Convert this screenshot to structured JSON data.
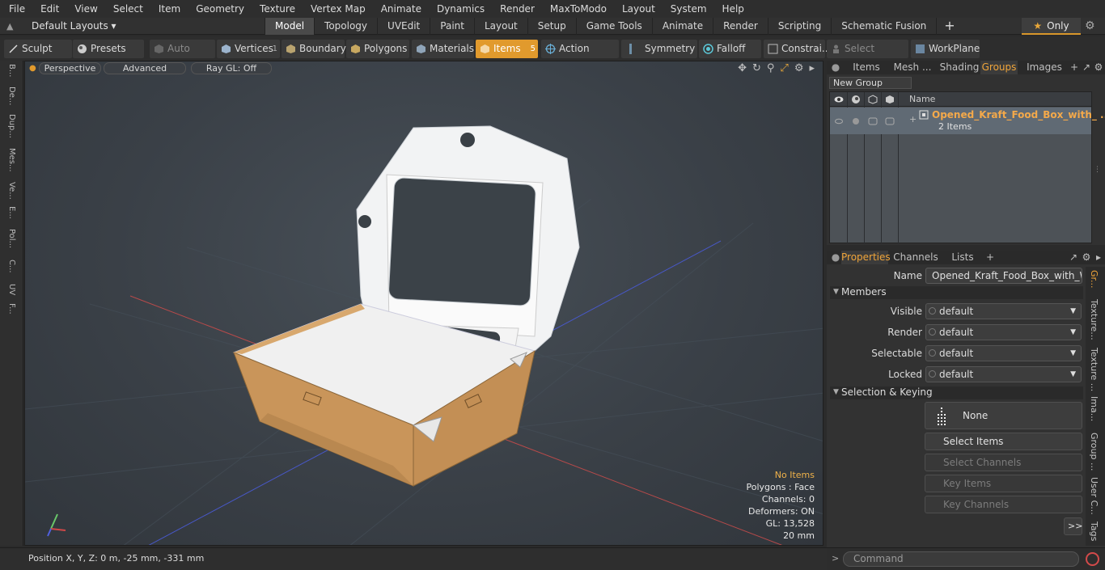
{
  "menu": [
    "File",
    "Edit",
    "View",
    "Select",
    "Item",
    "Geometry",
    "Texture",
    "Vertex Map",
    "Animate",
    "Dynamics",
    "Render",
    "MaxToModo",
    "Layout",
    "System",
    "Help"
  ],
  "layouts_label": "Default Layouts",
  "tabs": [
    "Model",
    "Topology",
    "UVEdit",
    "Paint",
    "Layout",
    "Setup",
    "Game Tools",
    "Animate",
    "Render",
    "Scripting",
    "Schematic Fusion"
  ],
  "active_tab": "Model",
  "only_label": "Only",
  "toolbar": {
    "sculpt": "Sculpt",
    "presets": "Presets",
    "auto_select": "Auto Select",
    "vertices": "Vertices",
    "vertices_count": "1",
    "boundary": "Boundary",
    "polygons": "Polygons",
    "materials": "Materials",
    "items": "Items",
    "items_count": "5",
    "action_center": "Action Center",
    "symmetry": "Symmetry",
    "falloff": "Falloff",
    "constraints": "Constrai...",
    "select_through": "Select Through",
    "workplane": "WorkPlane"
  },
  "left_strip": [
    "B...",
    "De...",
    "Dup...",
    "Mes...",
    "Ve...",
    "E...",
    "Pol...",
    "C...",
    "UV",
    "F..."
  ],
  "viewport": {
    "view": "Perspective",
    "shading": "Advanced",
    "raygl": "Ray GL: Off",
    "hud": {
      "items": "No Items",
      "polygons": "Polygons : Face",
      "channels": "Channels: 0",
      "deformers": "Deformers: ON",
      "gl": "GL: 13,528",
      "scale": "20 mm"
    }
  },
  "status": "Position X, Y, Z:   0 m, -25 mm, -331 mm",
  "top_panel": {
    "tabs": [
      "Items",
      "Mesh ...",
      "Shading",
      "Groups",
      "Images"
    ],
    "active": "Groups",
    "new_group": "New Group",
    "col_name": "Name",
    "group_name": "Opened_Kraft_Food_Box_with_ ...",
    "group_count": "2 Items"
  },
  "bottom_panel": {
    "tabs": [
      "Properties",
      "Channels",
      "Lists"
    ],
    "name_label": "Name",
    "name_value": "Opened_Kraft_Food_Box_with_Window",
    "members_label": "Members",
    "visible_label": "Visible",
    "visible_value": "default",
    "render_label": "Render",
    "render_value": "default",
    "selectable_label": "Selectable",
    "selectable_value": "default",
    "locked_label": "Locked",
    "locked_value": "default",
    "sel_keying_label": "Selection & Keying",
    "none_label": "None",
    "select_items": "Select Items",
    "select_channels": "Select Channels",
    "key_items": "Key Items",
    "key_channels": "Key Channels",
    "more": ">>"
  },
  "right_vtabs": [
    "Gr...",
    "Texture...",
    "Texture ...",
    "Ima...",
    "Group ...",
    "User C...",
    "Tags"
  ],
  "command_placeholder": "Command",
  "colors": {
    "accent": "#e19a2d",
    "box": "#c9955a",
    "selection_row": "#606a74"
  }
}
